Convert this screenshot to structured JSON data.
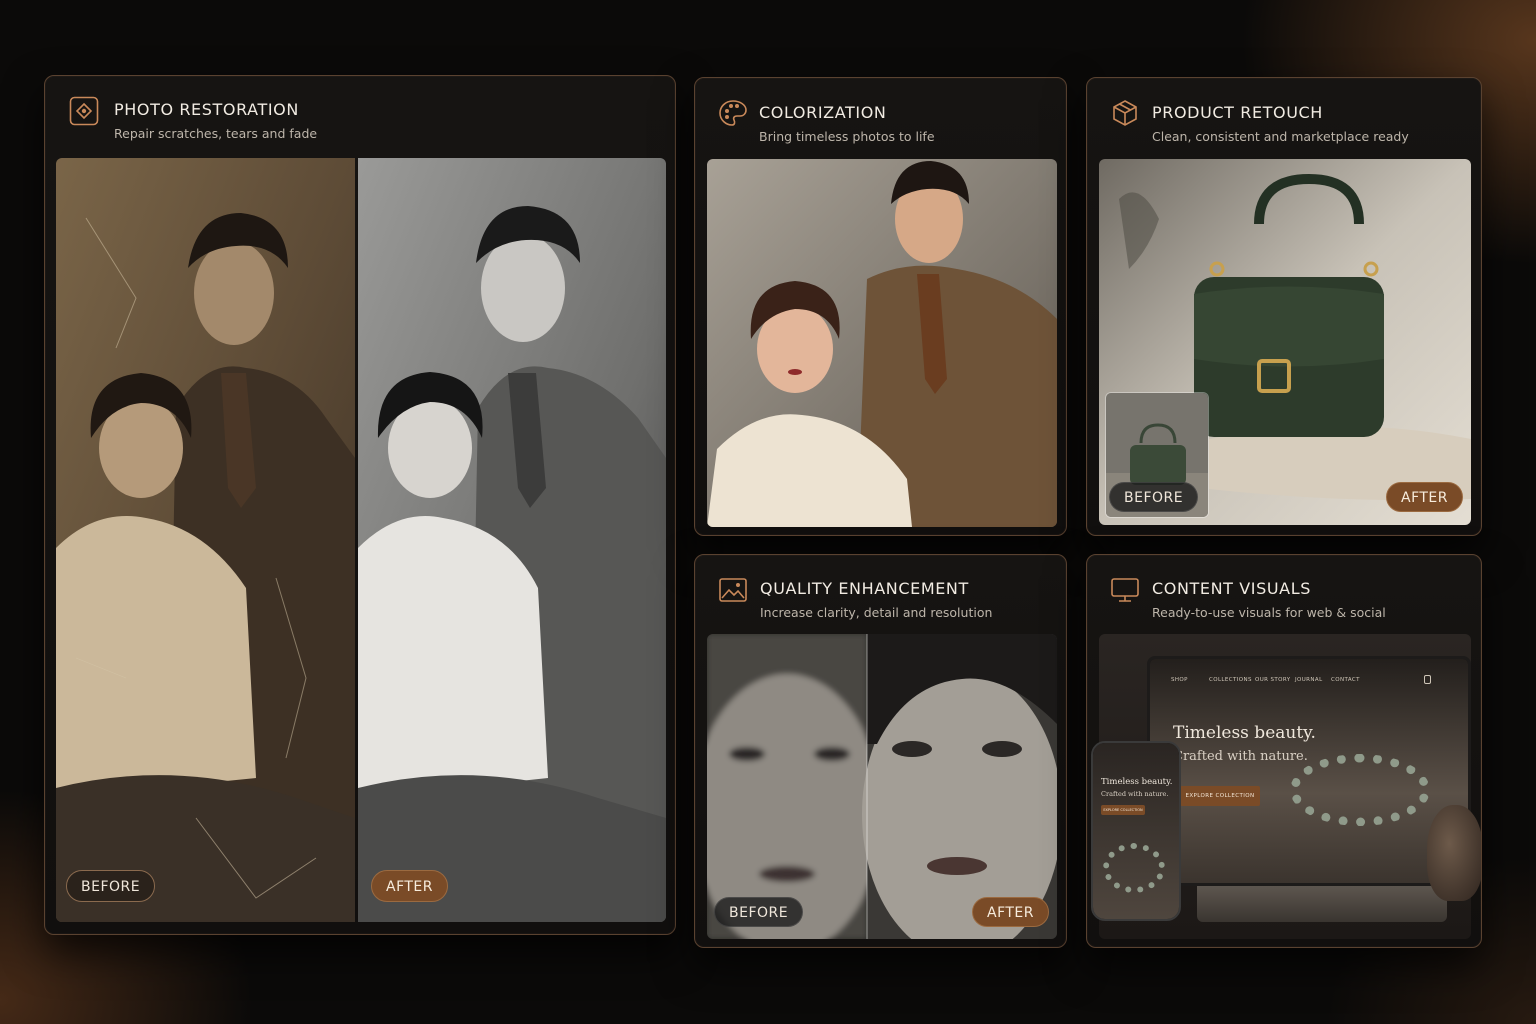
{
  "cards": {
    "restoration": {
      "icon": "restoration-icon",
      "title": "PHOTO RESTORATION",
      "subtitle": "Repair scratches, tears and fade",
      "before_label": "BEFORE",
      "after_label": "AFTER"
    },
    "colorization": {
      "icon": "palette-icon",
      "title": "COLORIZATION",
      "subtitle": "Bring timeless photos to life"
    },
    "product": {
      "icon": "box-icon",
      "title": "PRODUCT RETOUCH",
      "subtitle": "Clean, consistent and marketplace ready",
      "before_label": "BEFORE",
      "after_label": "AFTER"
    },
    "quality": {
      "icon": "image-icon",
      "title": "QUALITY ENHANCEMENT",
      "subtitle": "Increase clarity, detail and resolution",
      "before_label": "BEFORE",
      "after_label": "AFTER"
    },
    "content": {
      "icon": "monitor-icon",
      "title": "CONTENT VISUALS",
      "subtitle": "Ready-to-use visuals for web & social",
      "site": {
        "nav": [
          "SHOP",
          "COLLECTIONS",
          "OUR STORY",
          "JOURNAL",
          "CONTACT"
        ],
        "headline_1": "Timeless beauty.",
        "headline_2": "Crafted with nature.",
        "cta": "EXPLORE COLLECTION"
      },
      "phone": {
        "headline_1": "Timeless beauty.",
        "headline_2": "Crafted with nature.",
        "cta": "EXPLORE COLLECTION"
      }
    }
  },
  "colors": {
    "accent": "#c9895a",
    "border": "#5a4230",
    "after_pill": "#7a4b27"
  }
}
